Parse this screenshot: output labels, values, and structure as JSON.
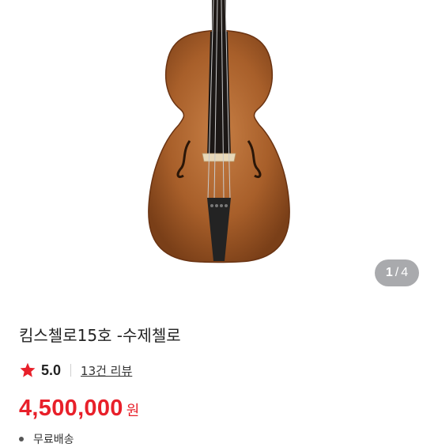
{
  "gallery": {
    "current": "1",
    "separator": "/",
    "total": "4",
    "image_alt_icon": "cello-product-image"
  },
  "product": {
    "title": "킴스첼로15호 -수제첼로",
    "rating": "5.0",
    "review_link": "13건 리뷰",
    "price": "4,500,000",
    "currency": "원",
    "shipping_label": "무료배송"
  },
  "colors": {
    "price": "#e8202a",
    "star": "#e8202a",
    "counter_bg": "#a9aaad"
  }
}
